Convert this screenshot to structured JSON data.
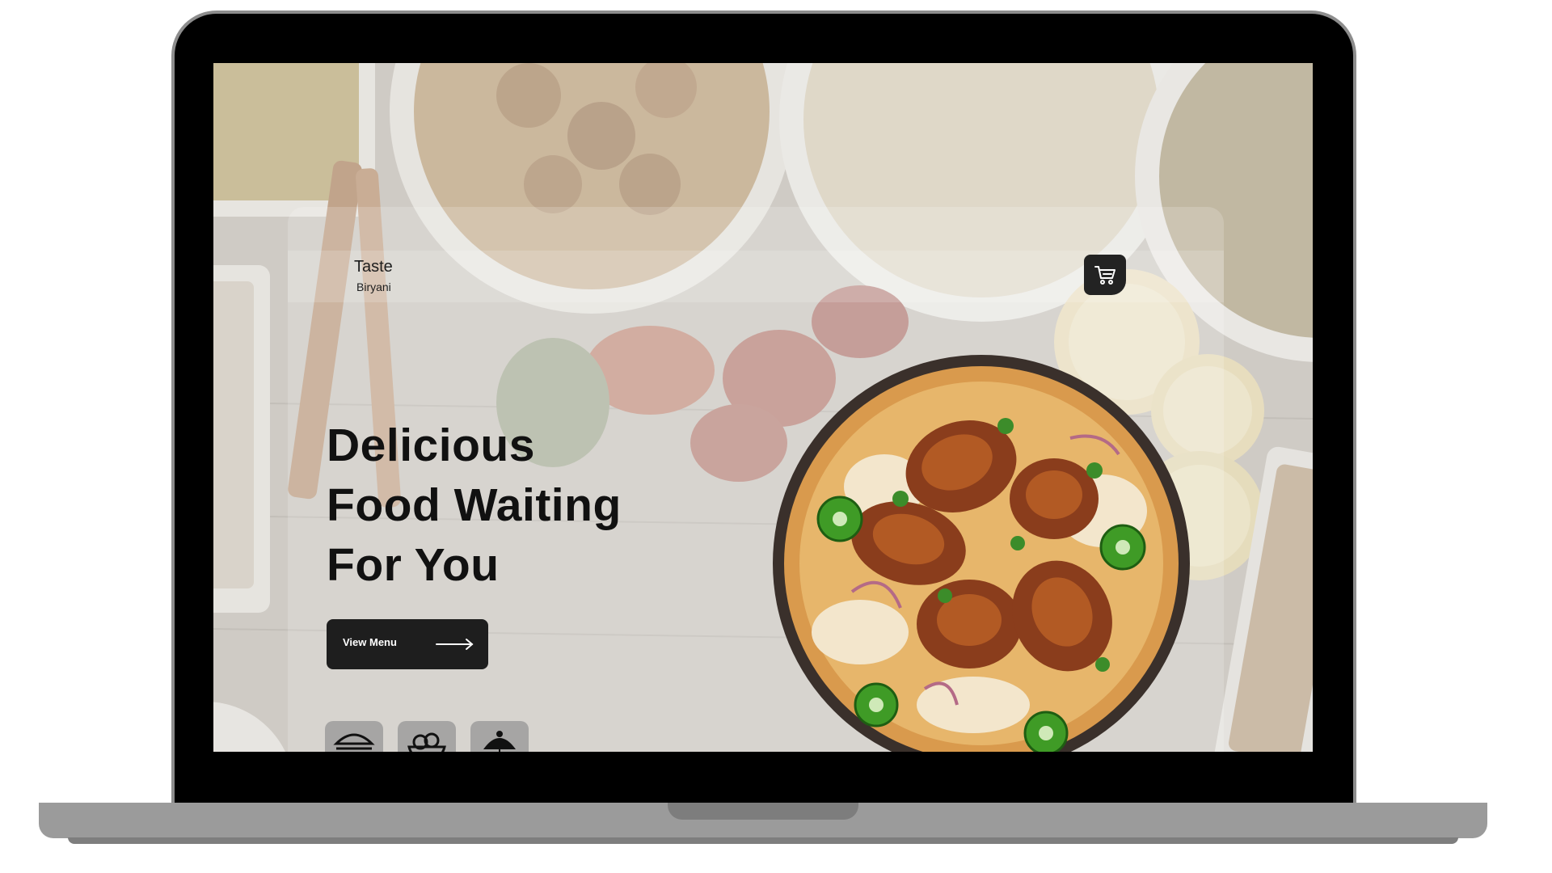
{
  "brand": {
    "line1": "Taste",
    "line2": "Biryani"
  },
  "hero": {
    "headline": [
      "Delicious",
      "Food Waiting",
      "For You"
    ],
    "cta_label": "View Menu"
  },
  "icons": {
    "cart": "shopping-cart-icon",
    "cta_arrow": "arrow-right-icon",
    "categories": [
      "burger-icon",
      "fruit-bowl-icon",
      "dessert-icon"
    ]
  },
  "colors": {
    "primary_dark": "#1e1e1e",
    "headline_text": "#111111",
    "accent_food": "#c8611e"
  }
}
